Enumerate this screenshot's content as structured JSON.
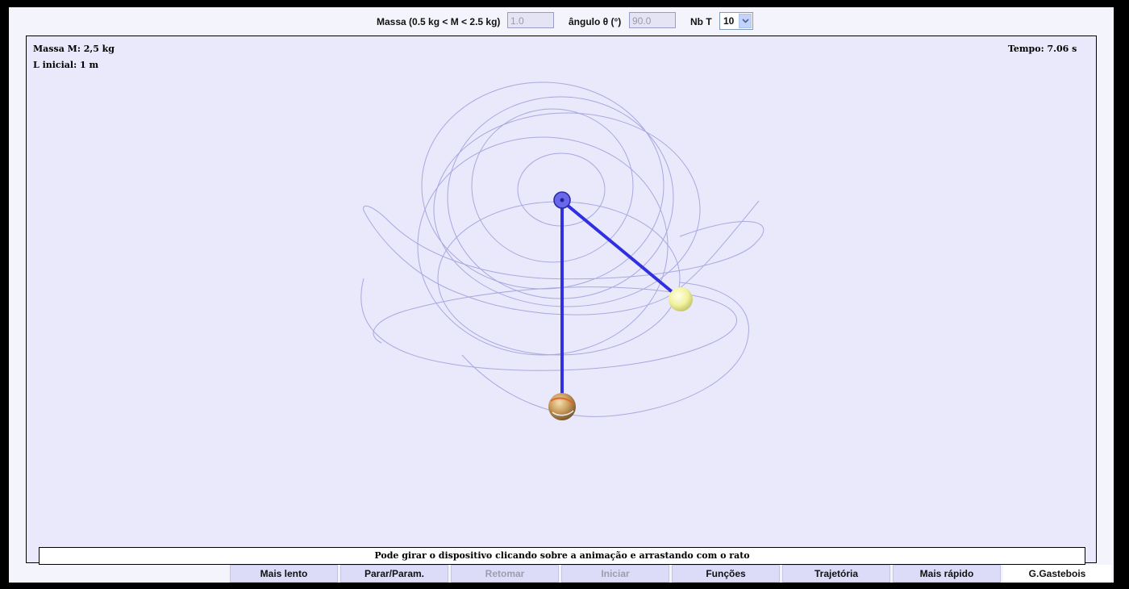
{
  "controls": {
    "mass_label": "Massa (0.5 kg < M < 2.5 kg)",
    "mass_value": "1.0",
    "angle_label": "ângulo θ (°)",
    "angle_value": "90.0",
    "nbt_label": "Nb T",
    "nbt_value": "10"
  },
  "info": {
    "mass": "Massa M: 2,5 kg",
    "length": "L inicial: 1 m",
    "time": "Tempo: 7.06 s"
  },
  "hint": "Pode girar o dispositivo clicando sobre a animação e arrastando com o rato",
  "buttons": {
    "slower": "Mais lento",
    "stop": "Parar/Param.",
    "resume": "Retomar",
    "start": "Iniciar",
    "functions": "Funções",
    "trajectory": "Trajetória",
    "faster": "Mais rápido"
  },
  "credit": "G.Gastebois",
  "colors": {
    "rope": "#3030e0",
    "trajectory": "#a8a8e0",
    "pivot": "#6868e8",
    "light_mass": "#f2f2a0",
    "heavy_mass": "#c89a5a",
    "background": "#e9e9fb"
  },
  "icons": {
    "dropdown": "chevron-down-icon"
  }
}
